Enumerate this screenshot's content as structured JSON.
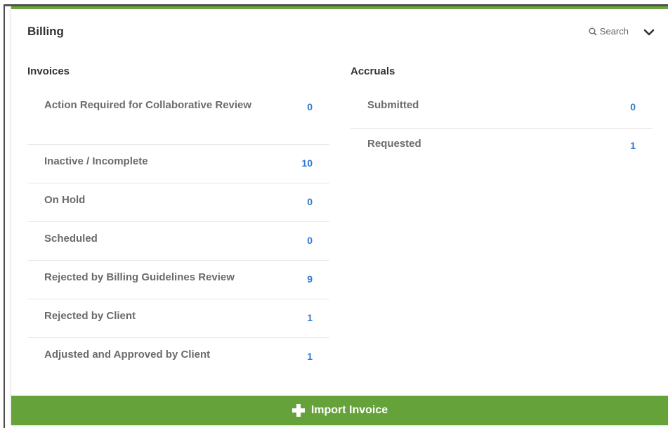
{
  "card": {
    "title": "Billing",
    "search_label": "Search",
    "accent_color": "#6aa63a"
  },
  "invoices": {
    "heading": "Invoices",
    "items": [
      {
        "label": "Action Required for Collaborative Review",
        "count": "0"
      },
      {
        "label": "Inactive / Incomplete",
        "count": "10"
      },
      {
        "label": "On Hold",
        "count": "0"
      },
      {
        "label": "Scheduled",
        "count": "0"
      },
      {
        "label": "Rejected by Billing Guidelines Review",
        "count": "9"
      },
      {
        "label": "Rejected by Client",
        "count": "1"
      },
      {
        "label": "Adjusted and Approved by Client",
        "count": "1"
      }
    ]
  },
  "accruals": {
    "heading": "Accruals",
    "items": [
      {
        "label": "Submitted",
        "count": "0"
      },
      {
        "label": "Requested",
        "count": "1"
      }
    ]
  },
  "footer": {
    "button_label": "Import Invoice",
    "button_color": "#66a23a"
  }
}
